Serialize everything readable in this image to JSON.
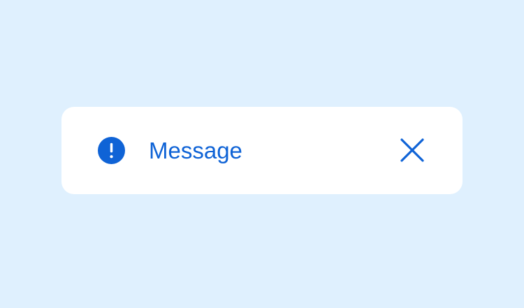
{
  "toast": {
    "message": "Message",
    "icon": "alert-circle-icon",
    "close_icon": "close-icon"
  },
  "colors": {
    "background": "#dff0fe",
    "card": "#ffffff",
    "accent": "#0f63d6"
  }
}
